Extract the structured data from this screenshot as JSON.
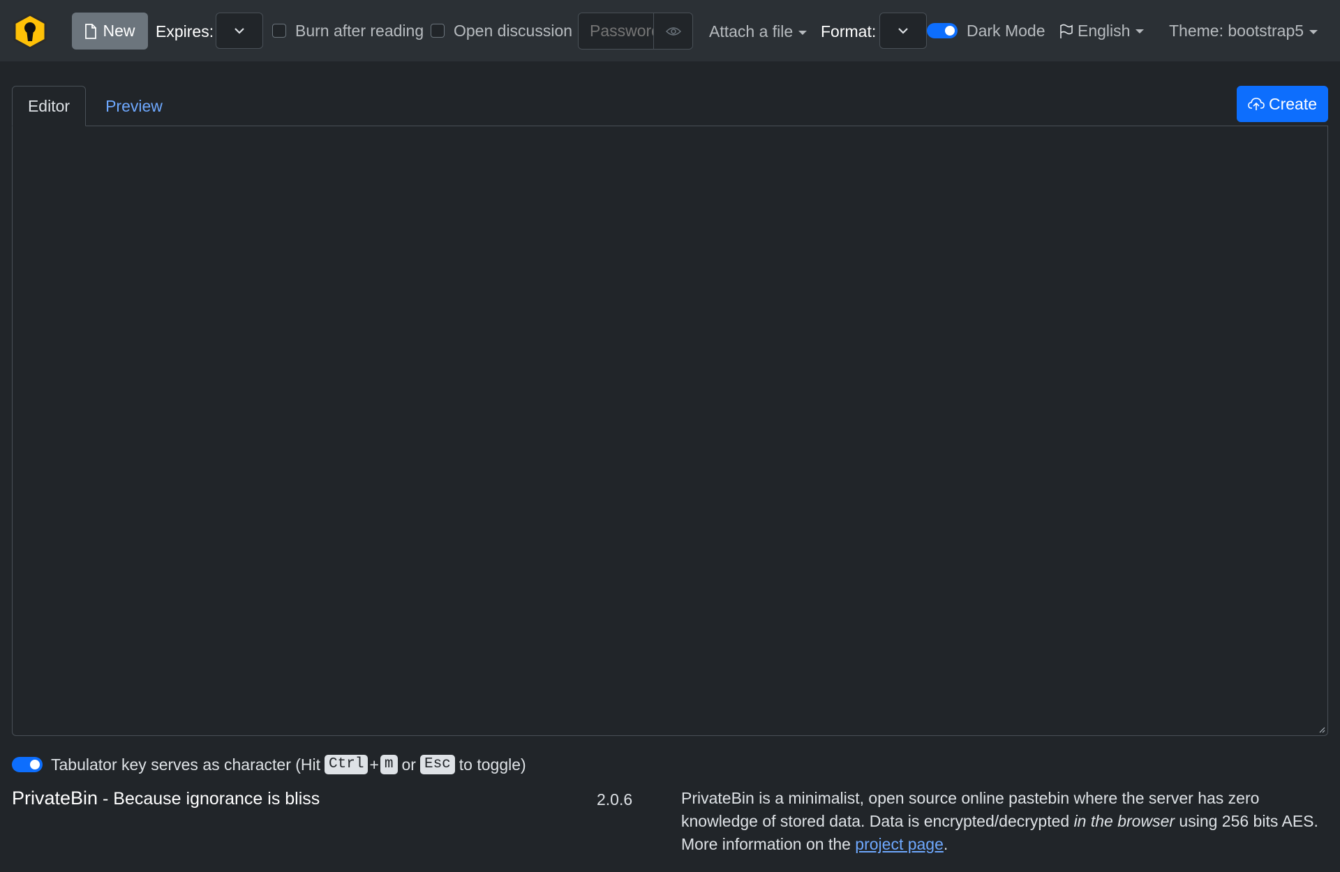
{
  "navbar": {
    "new_label": "New",
    "expires_label": "Expires:",
    "burn_label": "Burn after reading",
    "discussion_label": "Open discussion",
    "password_placeholder": "Password",
    "attach_label": "Attach a file",
    "format_label": "Format:",
    "dark_mode_label": "Dark Mode",
    "language_label": "English",
    "theme_label": "Theme: bootstrap5"
  },
  "tabs": {
    "editor": "Editor",
    "preview": "Preview"
  },
  "create_label": "Create",
  "tab_toggle": {
    "prefix": "Tabulator key serves as character (Hit",
    "key_ctrl": "Ctrl",
    "plus": "+",
    "key_m": "m",
    "or": "or",
    "key_esc": "Esc",
    "suffix": "to toggle)"
  },
  "footer": {
    "brand": "PrivateBin",
    "tagline": " - Because ignorance is bliss",
    "version": "2.0.6",
    "about_part1": "PrivateBin is a minimalist, open source online pastebin where the server has zero knowledge of stored data. Data is encrypted/decrypted ",
    "about_em": "in the browser",
    "about_part2": " using 256 bits AES. More information on the ",
    "about_link": "project page",
    "about_end": "."
  },
  "colors": {
    "background": "#212529",
    "navbar": "#2b3035",
    "primary": "#0d6efd",
    "secondary": "#6c757d",
    "link": "#6ea8fe"
  },
  "icons": [
    "privatebin-logo-icon",
    "new-document-icon",
    "chevron-down-icon",
    "eye-icon",
    "caret-down-icon",
    "flag-icon",
    "cloud-upload-icon",
    "resize-grip-icon"
  ]
}
